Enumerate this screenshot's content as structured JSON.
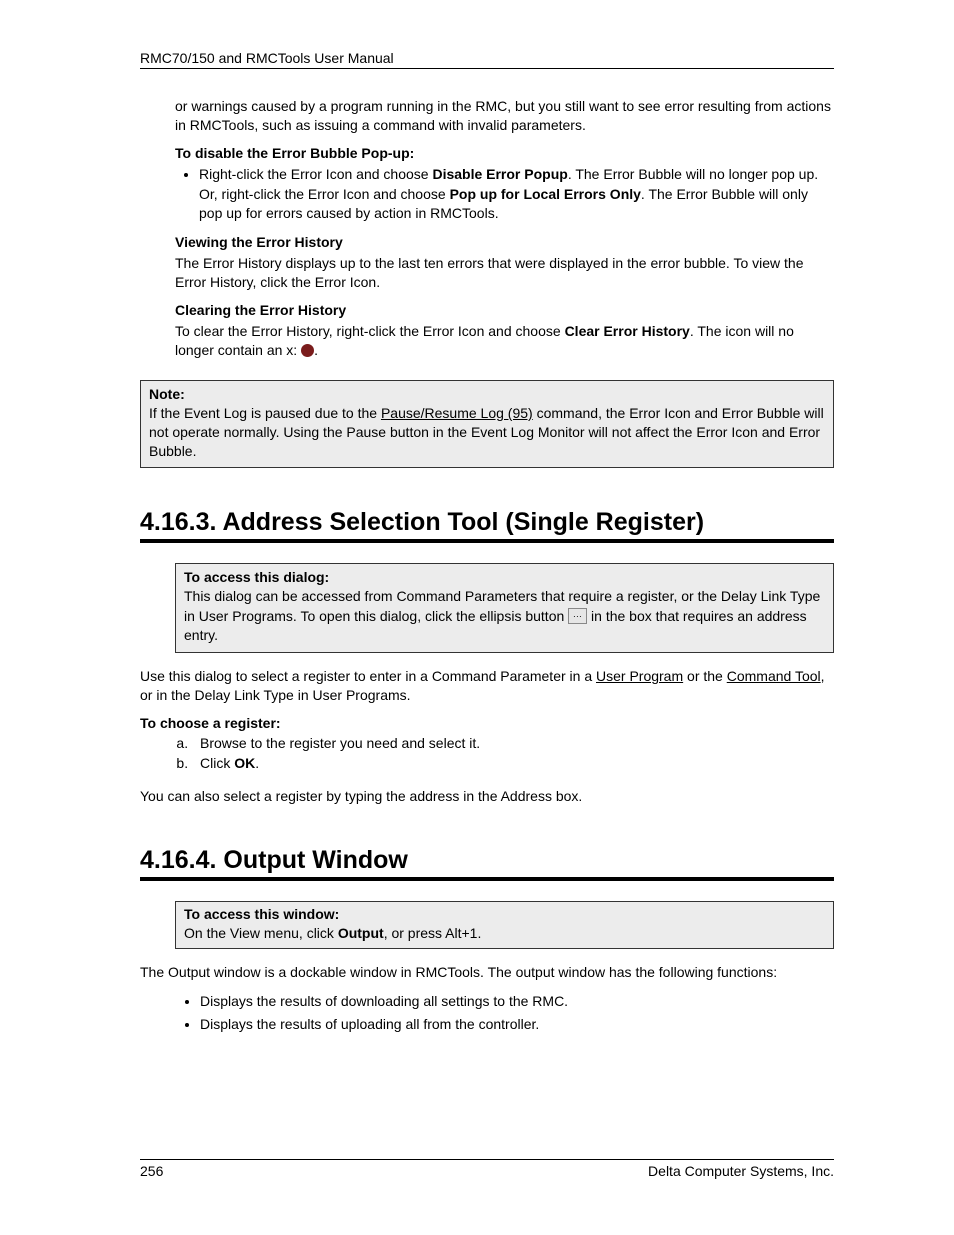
{
  "header": "RMC70/150 and RMCTools User Manual",
  "intro": {
    "continuation": "or warnings caused by a program running in the RMC, but you still want to see error resulting from actions in RMCTools, such as issuing a command with invalid parameters.",
    "disableHeading": "To disable the Error Bubble Pop-up:",
    "bullet_prefix": "Right-click the Error Icon and choose ",
    "bullet_bold1": "Disable Error Popup",
    "bullet_suffix1": ". The Error Bubble will no longer pop up.",
    "bullet_or": "Or, right-click the Error Icon and choose ",
    "bullet_bold2": "Pop up for Local Errors Only",
    "bullet_suffix2": ". The Error Bubble will only pop up for errors caused by action in RMCTools.",
    "viewingHeading": "Viewing the Error History",
    "viewingPara": "The Error History displays up to the last ten errors that were displayed in the error bubble. To view the Error History, click the Error Icon.",
    "clearingHeading": "Clearing the Error History",
    "clearing_prefix": "To clear the Error History, right-click the Error Icon and choose ",
    "clearing_bold": "Clear Error History",
    "clearing_suffix": ". The icon will no longer contain an x: ",
    "clearing_period": "."
  },
  "note": {
    "label": "Note:",
    "text_prefix": "If the Event Log is paused due to the ",
    "text_link": "Pause/Resume Log (95)",
    "text_suffix": " command, the Error Icon and Error Bubble will not operate normally. Using the Pause button in the Event Log Monitor will not affect the Error Icon and Error Bubble."
  },
  "section3": {
    "heading": "4.16.3. Address Selection Tool (Single Register)",
    "access_label": "To access this dialog:",
    "access_line1": "This dialog can be accessed from Command Parameters that require a register, or the Delay Link Type in User Programs. To open this dialog, click the ellipsis button ",
    "access_suffix": " in the box that requires an address entry.",
    "use_prefix": "Use this dialog to select a register to enter in a Command Parameter in a ",
    "use_link1": "User Program",
    "use_mid": " or the ",
    "use_link2": "Command Tool",
    "use_suffix": ", or in the Delay Link Type in User Programs.",
    "choose_label": "To choose a register:",
    "step_a": "Browse to the register you need and select it.",
    "step_b_prefix": "Click ",
    "step_b_bold": "OK",
    "step_b_suffix": ".",
    "also": "You can also select a register by typing the address in the Address box."
  },
  "section4": {
    "heading": "4.16.4. Output Window",
    "access_label": "To access this window:",
    "access_prefix": "On the View menu, click ",
    "access_bold": "Output",
    "access_suffix": ", or press Alt+1.",
    "para": "The Output window is a dockable window in RMCTools. The output window has the following functions:",
    "bullet1": "Displays the results of downloading all settings to the RMC.",
    "bullet2": "Displays the results of uploading all from the controller."
  },
  "footer": {
    "page": "256",
    "company": "Delta Computer Systems, Inc."
  }
}
